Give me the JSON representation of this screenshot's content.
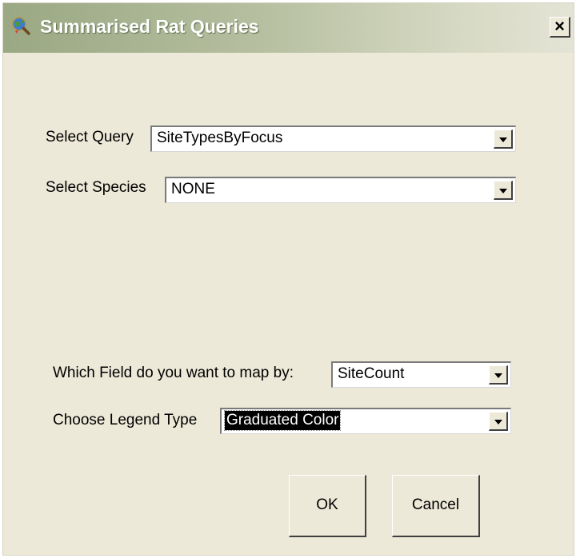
{
  "window": {
    "title": "Summarised Rat Queries",
    "close_label": "×",
    "icon": "globe-magnifier-icon"
  },
  "form": {
    "query": {
      "label": "Select Query",
      "value": "SiteTypesByFocus"
    },
    "species": {
      "label": "Select Species",
      "value": "NONE"
    },
    "map_field": {
      "label": "Which Field do you want to map by:",
      "value": "SiteCount"
    },
    "legend_type": {
      "label": "Choose Legend Type",
      "value": "Graduated Color"
    }
  },
  "buttons": {
    "ok_label": "OK",
    "cancel_label": "Cancel"
  },
  "colors": {
    "dialog_background": "#ece9d8",
    "titlebar_start": "#9aa883",
    "titlebar_end": "#e4e4d6",
    "selection_background": "#000000"
  }
}
